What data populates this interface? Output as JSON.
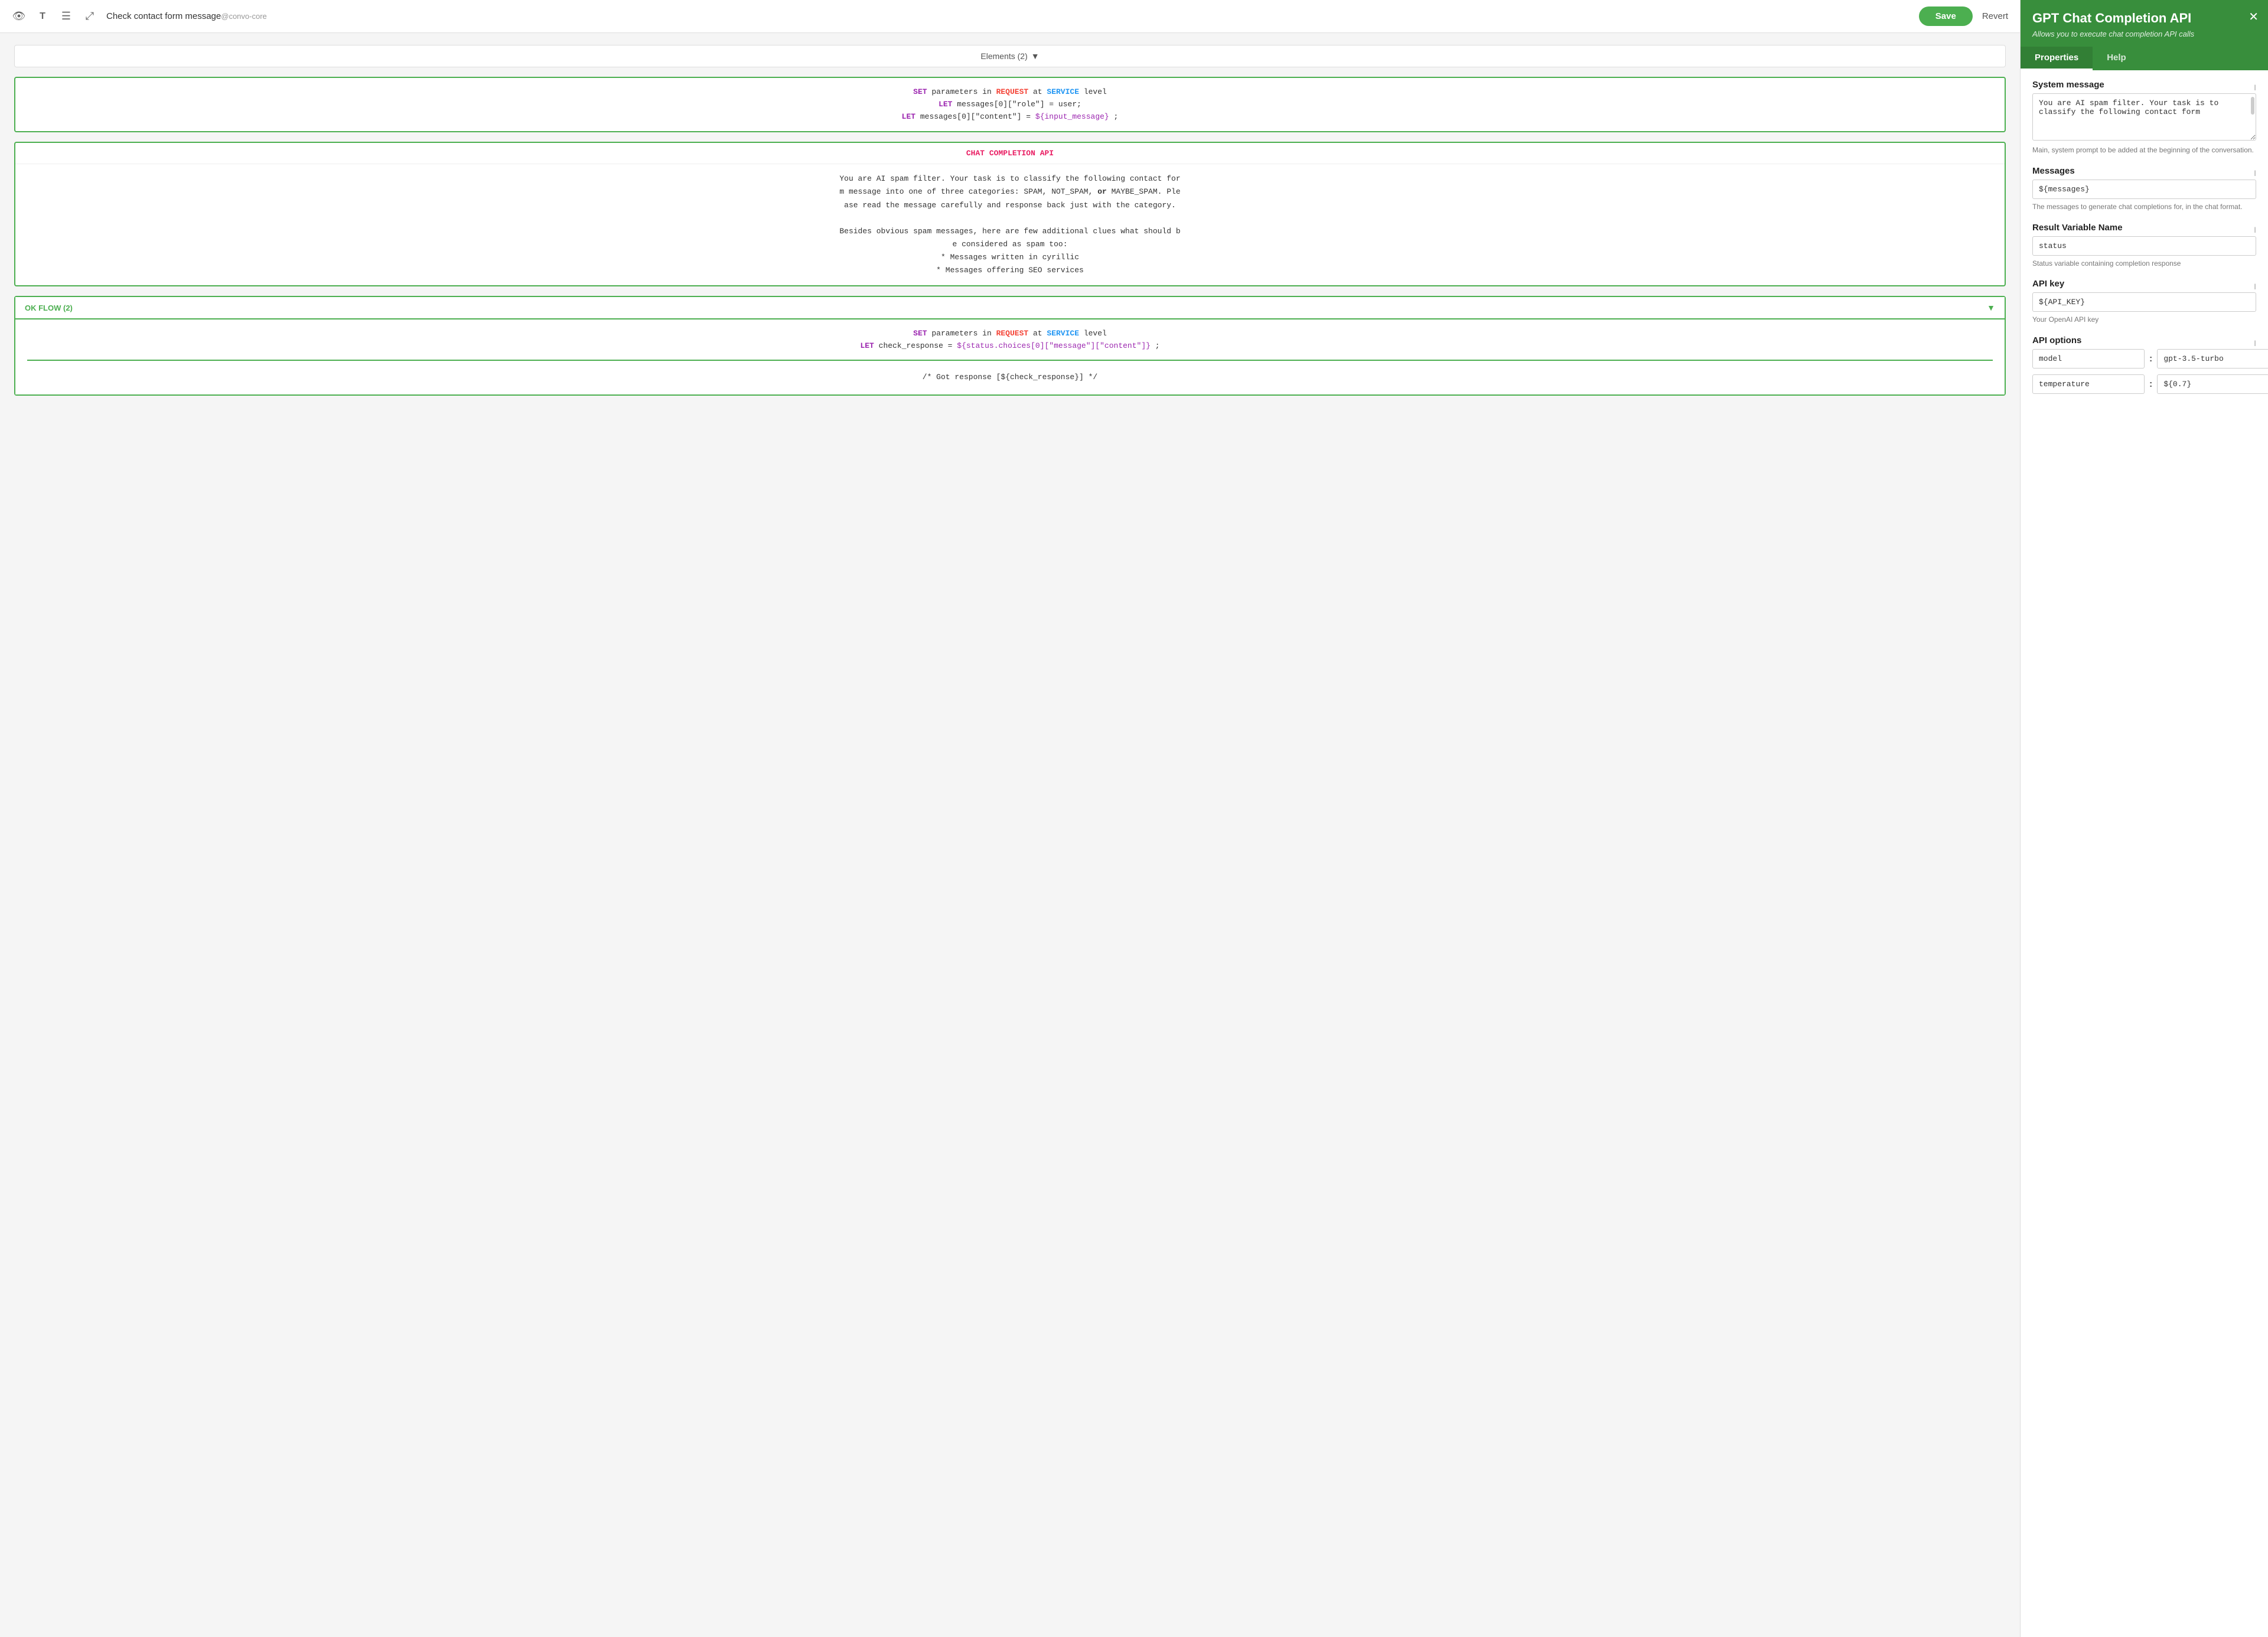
{
  "toolbar": {
    "save_label": "Save",
    "revert_label": "Revert",
    "workflow_name": "Check contact form message",
    "workflow_tag": "@convo-core"
  },
  "canvas": {
    "elements_header": "Elements (2)",
    "code_block1": {
      "line1": "SET parameters in REQUEST at SERVICE level",
      "line2": "LET messages[0][\"role\"] = user;",
      "line3": "LET messages[0][\"content\"] = ${input_message};"
    },
    "chat_block": {
      "header": "CHAT COMPLETION API",
      "body": "You are AI spam filter. Your task is to classify the following contact for\nm message into one of three categories: SPAM, NOT_SPAM, or MAYBE_SPAM. Ple\nase read the message carefully and response back just with the category.\n\nBesides obvious spam messages, here are few additional clues what should b\ne considered as spam too:\n    * Messages written in cyrillic\n    * Messages offering SEO services"
    },
    "ok_flow": {
      "label": "OK FLOW (2)",
      "code_line1": "SET parameters in REQUEST at SERVICE level",
      "code_line2": "LET check_response = ${status.choices[0][\"message\"][\"content\"]};",
      "comment": "/*    Got response [${check_response}]    */"
    }
  },
  "right_panel": {
    "title": "GPT Chat Completion API",
    "subtitle": "Allows you to execute chat completion API calls",
    "tabs": [
      "Properties",
      "Help"
    ],
    "active_tab": "Properties",
    "fields": {
      "system_message": {
        "label": "System message",
        "value": "You are AI spam filter. Your task is to classify the following contact form",
        "description": "Main, system prompt to be added at the beginning of the conversation."
      },
      "messages": {
        "label": "Messages",
        "value": "${messages}",
        "description": "The messages to generate chat completions for, in the chat format."
      },
      "result_variable": {
        "label": "Result Variable Name",
        "value": "status",
        "description": "Status variable containing completion response"
      },
      "api_key": {
        "label": "API key",
        "value": "${API_KEY}",
        "description": "Your OpenAI API key"
      },
      "api_options": {
        "label": "API options",
        "rows": [
          {
            "key": "model",
            "value": "gpt-3.5-turbo"
          },
          {
            "key": "temperature",
            "value": "${0.7}"
          }
        ]
      }
    }
  }
}
